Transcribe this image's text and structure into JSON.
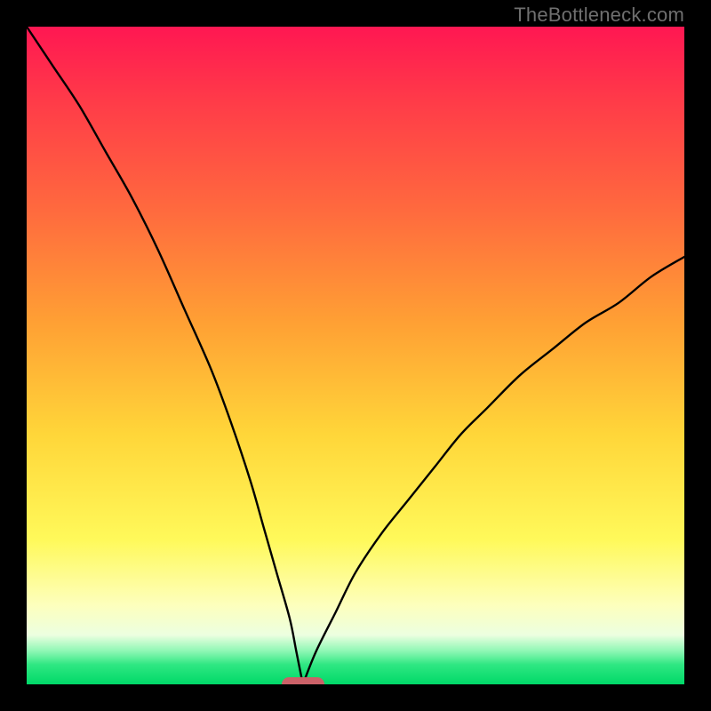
{
  "credit_text": "TheBottleneck.com",
  "colors": {
    "page_bg": "#000000",
    "curve": "#000000",
    "marker": "#cb6168",
    "credit": "#6f6f6f"
  },
  "chart_data": {
    "type": "line",
    "title": "",
    "xlabel": "",
    "ylabel": "",
    "xlim": [
      0,
      100
    ],
    "ylim": [
      0,
      100
    ],
    "grid": false,
    "legend": false,
    "note": "V-shaped bottleneck curve with minimum near x≈42; two branches: steep descending from top-left, gentler ascending toward upper-right reaching ~y≈65 at right edge; coloured background gradient red→green encodes y; rounded marker pill on x-axis at the minimum.",
    "series": [
      {
        "name": "left-branch",
        "x": [
          0,
          4,
          8,
          12,
          16,
          20,
          24,
          28,
          31,
          34,
          36,
          38,
          40,
          41,
          42
        ],
        "y": [
          100,
          94,
          88,
          81,
          74,
          66,
          57,
          48,
          40,
          31,
          24,
          17,
          10,
          5,
          0
        ]
      },
      {
        "name": "right-branch",
        "x": [
          42,
          44,
          47,
          50,
          54,
          58,
          62,
          66,
          70,
          75,
          80,
          85,
          90,
          95,
          100
        ],
        "y": [
          0,
          5,
          11,
          17,
          23,
          28,
          33,
          38,
          42,
          47,
          51,
          55,
          58,
          62,
          65
        ]
      }
    ],
    "marker": {
      "x": 42,
      "y": 0,
      "width_pct": 6
    }
  }
}
